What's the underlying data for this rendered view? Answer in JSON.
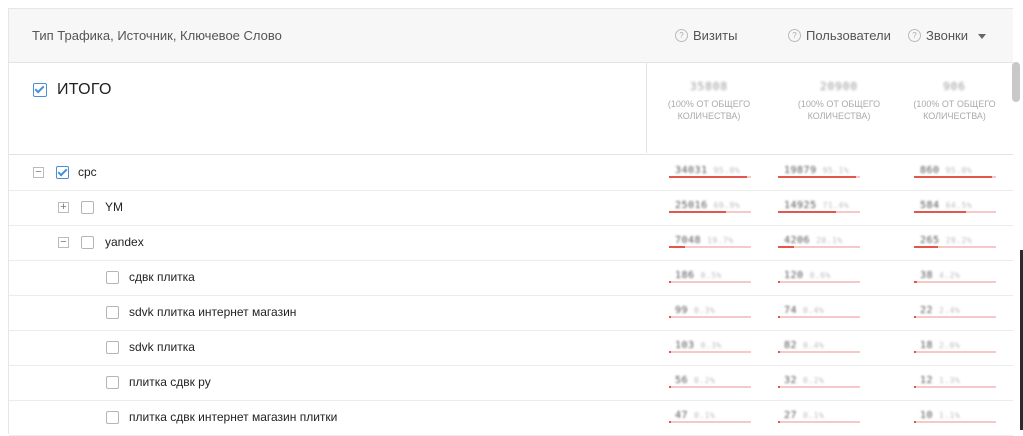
{
  "header": {
    "dimension_label": "Тип Трафика, Источник, Ключевое Слово",
    "columns": [
      {
        "label": "Визиты",
        "help_icon": "question-circle-icon"
      },
      {
        "label": "Пользователи",
        "help_icon": "question-circle-icon"
      },
      {
        "label": "Звонки",
        "help_icon": "question-circle-icon",
        "sort_icon": "sort-caret-down-icon"
      }
    ]
  },
  "total": {
    "label": "ИТОГО",
    "checked": true,
    "values": [
      {
        "value": "35808",
        "share": "(100% ОТ ОБЩЕГО КОЛИЧЕСТВА)"
      },
      {
        "value": "20900",
        "share": "(100% ОТ ОБЩЕГО КОЛИЧЕСТВА)"
      },
      {
        "value": "906",
        "share": "(100% ОТ ОБЩЕГО КОЛИЧЕСТВА)"
      }
    ]
  },
  "rows": [
    {
      "label": "cpc",
      "checked": true,
      "toggle": "−",
      "cells": [
        {
          "value": "34031",
          "pct": "95.0%",
          "bar": 0.95
        },
        {
          "value": "19879",
          "pct": "95.1%",
          "bar": 0.95
        },
        {
          "value": "860",
          "pct": "95.0%",
          "bar": 0.95
        }
      ]
    },
    {
      "label": "YM",
      "checked": false,
      "toggle": "+",
      "cells": [
        {
          "value": "25016",
          "pct": "69.9%",
          "bar": 0.7
        },
        {
          "value": "14925",
          "pct": "71.4%",
          "bar": 0.71
        },
        {
          "value": "584",
          "pct": "64.5%",
          "bar": 0.64
        }
      ]
    },
    {
      "label": "yandex",
      "checked": false,
      "toggle": "−",
      "cells": [
        {
          "value": "7048",
          "pct": "19.7%",
          "bar": 0.2
        },
        {
          "value": "4206",
          "pct": "20.1%",
          "bar": 0.2
        },
        {
          "value": "265",
          "pct": "29.2%",
          "bar": 0.29
        }
      ]
    },
    {
      "label": "сдвк плитка",
      "checked": false,
      "toggle": "",
      "cells": [
        {
          "value": "186",
          "pct": "0.5%",
          "bar": 0.02
        },
        {
          "value": "120",
          "pct": "0.6%",
          "bar": 0.02
        },
        {
          "value": "38",
          "pct": "4.2%",
          "bar": 0.04
        }
      ]
    },
    {
      "label": "sdvk плитка интернет магазин",
      "checked": false,
      "toggle": "",
      "cells": [
        {
          "value": "99",
          "pct": "0.3%",
          "bar": 0.01
        },
        {
          "value": "74",
          "pct": "0.4%",
          "bar": 0.01
        },
        {
          "value": "22",
          "pct": "2.4%",
          "bar": 0.02
        }
      ]
    },
    {
      "label": "sdvk плитка",
      "checked": false,
      "toggle": "",
      "cells": [
        {
          "value": "103",
          "pct": "0.3%",
          "bar": 0.01
        },
        {
          "value": "82",
          "pct": "0.4%",
          "bar": 0.01
        },
        {
          "value": "18",
          "pct": "2.0%",
          "bar": 0.02
        }
      ]
    },
    {
      "label": "плитка сдвк ру",
      "checked": false,
      "toggle": "",
      "cells": [
        {
          "value": "56",
          "pct": "0.2%",
          "bar": 0.01
        },
        {
          "value": "32",
          "pct": "0.2%",
          "bar": 0.01
        },
        {
          "value": "12",
          "pct": "1.3%",
          "bar": 0.01
        }
      ]
    },
    {
      "label": "плитка сдвк интернет магазин плитки",
      "checked": false,
      "toggle": "",
      "cells": [
        {
          "value": "47",
          "pct": "0.1%",
          "bar": 0.01
        },
        {
          "value": "27",
          "pct": "0.1%",
          "bar": 0.01
        },
        {
          "value": "10",
          "pct": "1.1%",
          "bar": 0.01
        }
      ]
    }
  ],
  "colors": {
    "accent": "#4a90d9",
    "bar": "#e2574c",
    "bar_bg": "#f6c9c9"
  }
}
